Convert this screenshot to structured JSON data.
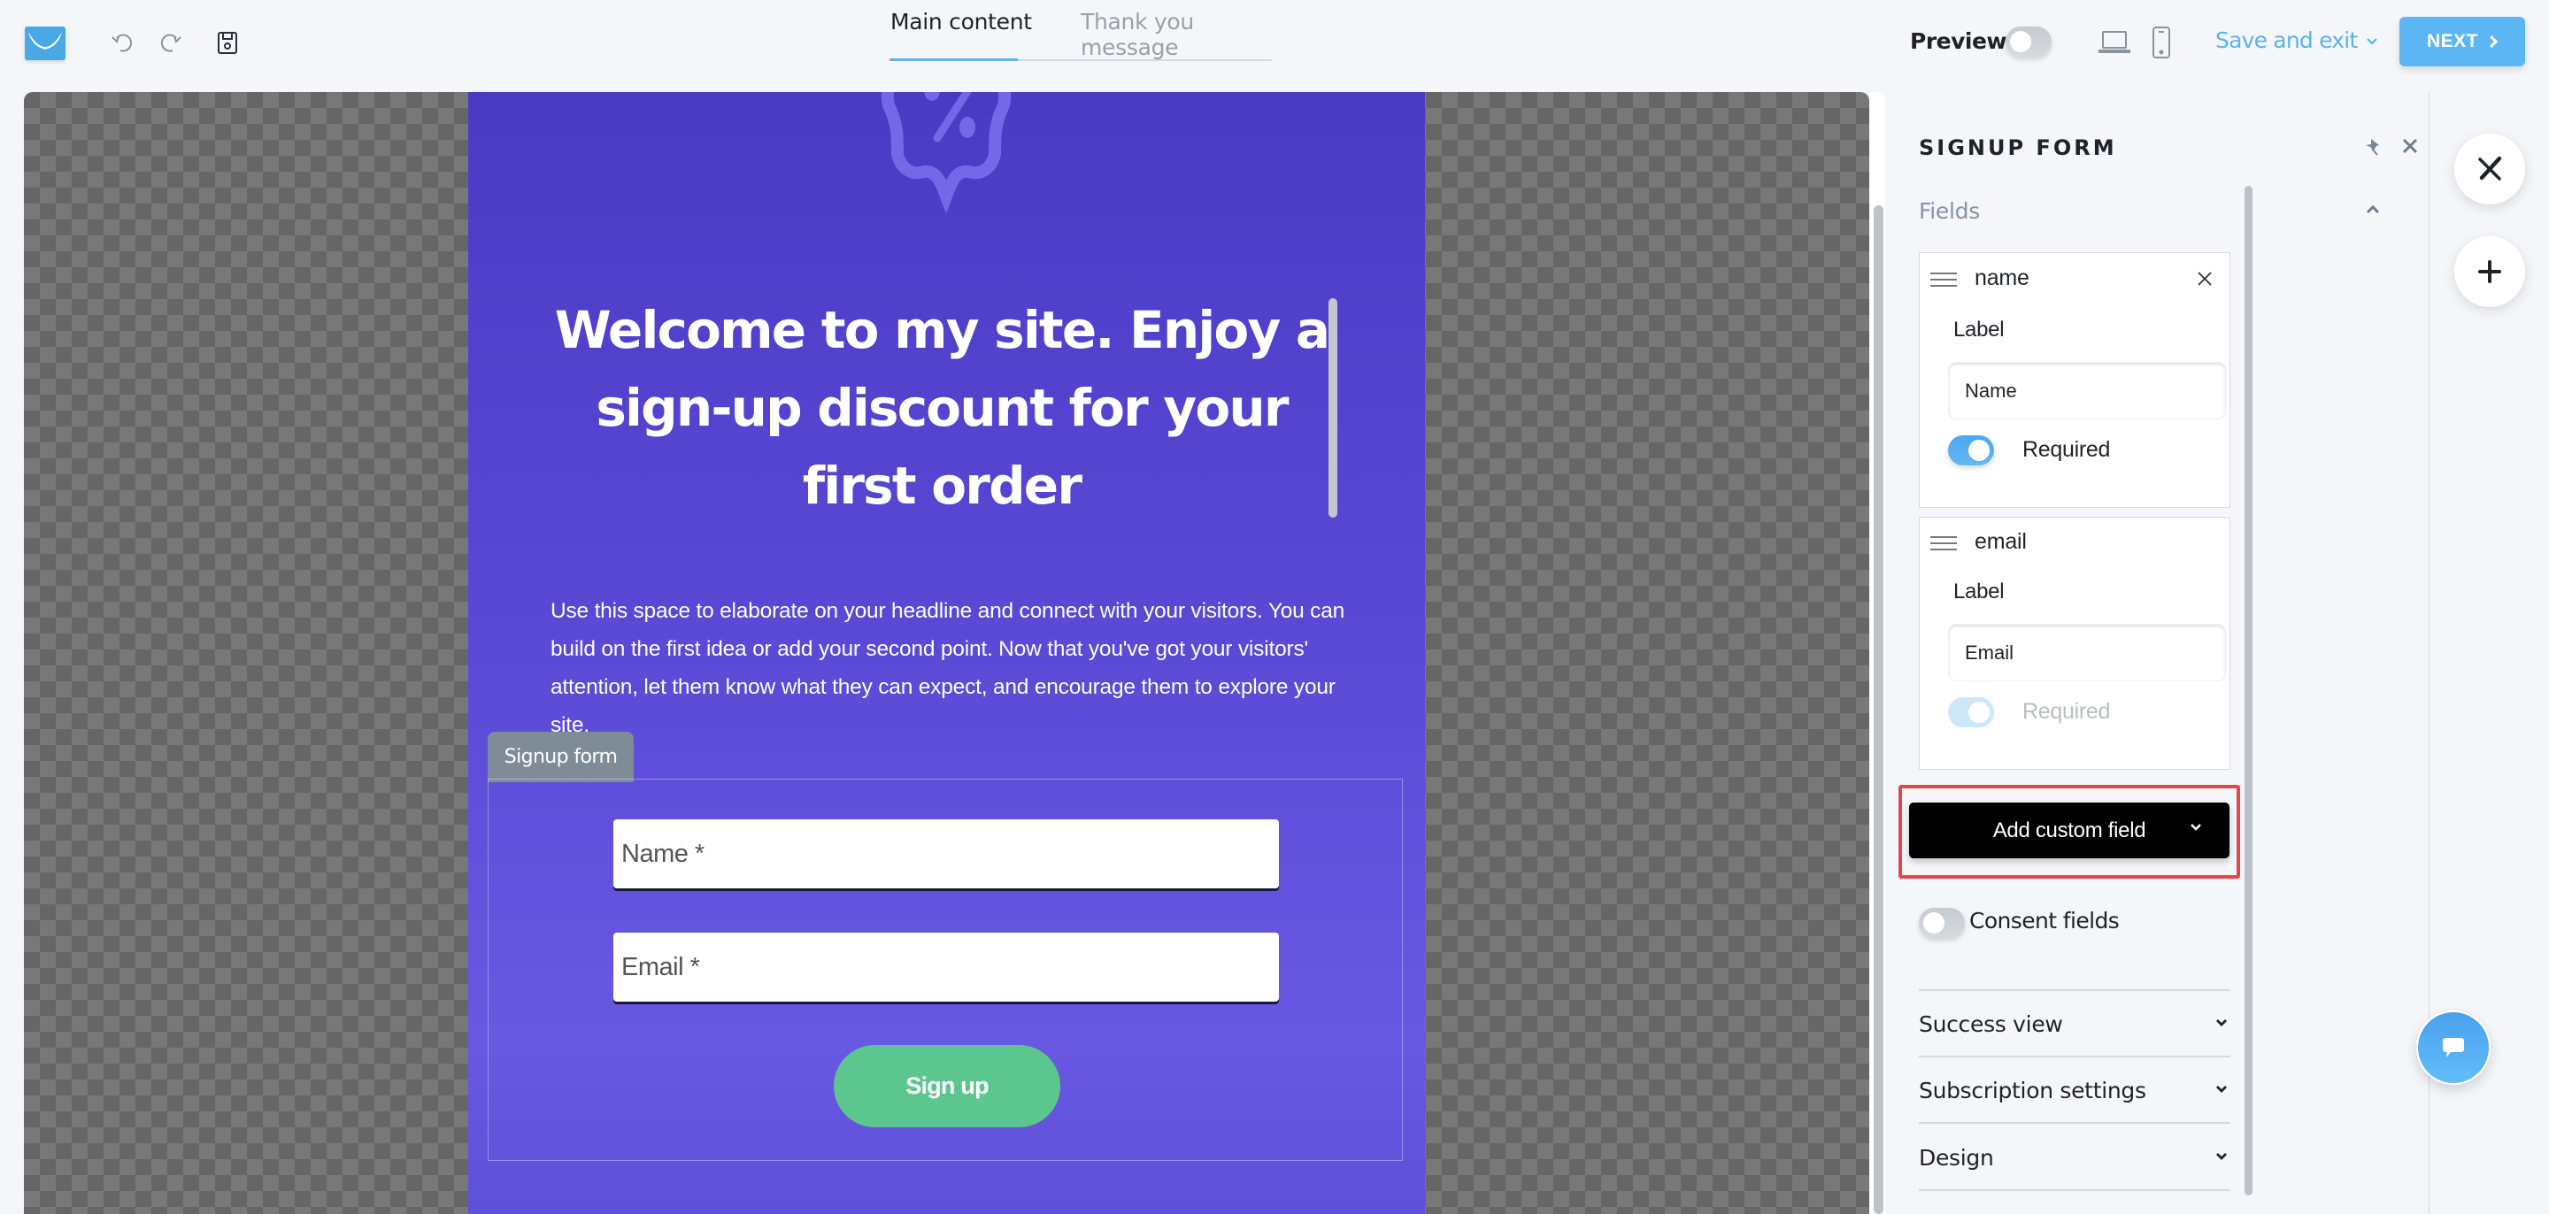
{
  "header": {
    "logo": "getresponse-logo-icon",
    "undo_icon": "undo-icon",
    "redo_icon": "redo-icon",
    "save_icon": "save-icon",
    "tabs": [
      {
        "label": "Main content",
        "active": true
      },
      {
        "label": "Thank you message",
        "active": false
      }
    ],
    "preview_label": "Preview",
    "preview_enabled": false,
    "desktop_icon": "laptop-icon",
    "mobile_icon": "mobile-icon",
    "save_exit_label": "Save and exit",
    "next_label": "NEXT",
    "colors": {
      "accent": "#5db6f4"
    }
  },
  "canvas": {
    "badge_icon": "discount-badge-icon",
    "headline": "Welcome to my site. Enjoy a sign-up discount for your first order",
    "body": "Use this space to elaborate on your headline and connect with your visitors. You can build on the first idea or add your second point. Now that you've got your visitors' attention, let them know what they can expect, and encourage them to explore your site.",
    "form_tag": "Signup form",
    "form": {
      "name_placeholder": "Name *",
      "email_placeholder": "Email *",
      "submit_label": "Sign up"
    },
    "colors": {
      "card": "#5848d4",
      "button": "#5bc78f"
    }
  },
  "panel": {
    "title": "SIGNUP FORM",
    "fields_section": "Fields",
    "fields": [
      {
        "name": "name",
        "label_caption": "Label",
        "label_value": "Name",
        "required_label": "Required",
        "required": true,
        "required_disabled": false,
        "removable": true
      },
      {
        "name": "email",
        "label_caption": "Label",
        "label_value": "Email",
        "required_label": "Required",
        "required": true,
        "required_disabled": true,
        "removable": false
      }
    ],
    "add_custom_field_label": "Add custom field",
    "consent_label": "Consent fields",
    "consent_enabled": false,
    "sections": [
      {
        "label": "Success view"
      },
      {
        "label": "Subscription settings"
      },
      {
        "label": "Design"
      }
    ],
    "highlight_color": "#e0484e"
  },
  "rail": {
    "tools_icon": "design-tools-icon",
    "add_icon": "plus-icon",
    "chat_icon": "chat-bubble-icon"
  }
}
